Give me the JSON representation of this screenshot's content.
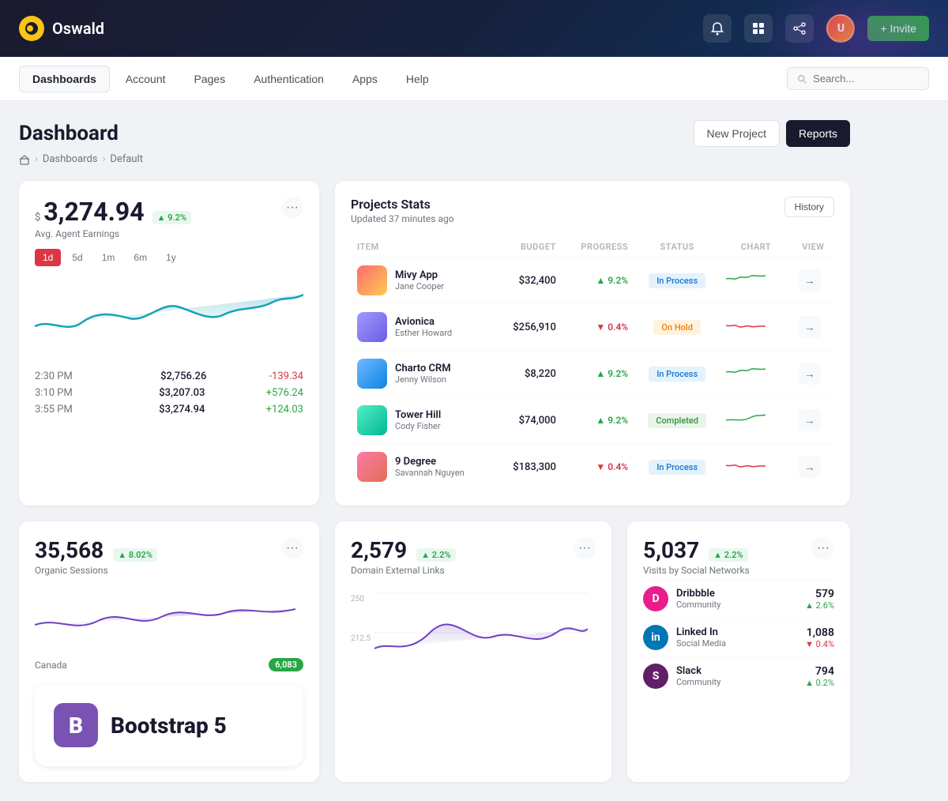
{
  "header": {
    "logo_text": "Oswald",
    "invite_label": "+ Invite"
  },
  "nav": {
    "items": [
      {
        "label": "Dashboards",
        "active": true
      },
      {
        "label": "Account",
        "active": false
      },
      {
        "label": "Pages",
        "active": false
      },
      {
        "label": "Authentication",
        "active": false
      },
      {
        "label": "Apps",
        "active": false
      },
      {
        "label": "Help",
        "active": false
      }
    ],
    "search_placeholder": "Search..."
  },
  "page": {
    "title": "Dashboard",
    "breadcrumb": [
      "Dashboards",
      "Default"
    ],
    "actions": {
      "new_project": "New Project",
      "reports": "Reports"
    }
  },
  "earnings_card": {
    "currency": "$",
    "amount": "3,274.94",
    "badge": "▲ 9.2%",
    "label": "Avg. Agent Earnings",
    "time_filters": [
      "1d",
      "5d",
      "1m",
      "6m",
      "1y"
    ],
    "active_filter": "1d",
    "entries": [
      {
        "time": "2:30 PM",
        "amount": "$2,756.26",
        "change": "-139.34",
        "pos": false
      },
      {
        "time": "3:10 PM",
        "amount": "$3,207.03",
        "change": "+576.24",
        "pos": true
      },
      {
        "time": "3:55 PM",
        "amount": "$3,274.94",
        "change": "+124.03",
        "pos": true
      }
    ]
  },
  "projects_card": {
    "title": "Projects Stats",
    "updated": "Updated 37 minutes ago",
    "history_btn": "History",
    "columns": [
      "ITEM",
      "BUDGET",
      "PROGRESS",
      "STATUS",
      "CHART",
      "VIEW"
    ],
    "rows": [
      {
        "name": "Mivy App",
        "person": "Jane Cooper",
        "budget": "$32,400",
        "progress": "▲ 9.2%",
        "progress_up": true,
        "status": "In Process",
        "thumb_color": "#ff6b6b"
      },
      {
        "name": "Avionica",
        "person": "Esther Howard",
        "budget": "$256,910",
        "progress": "▼ 0.4%",
        "progress_up": false,
        "status": "On Hold",
        "thumb_color": "#a29bfe"
      },
      {
        "name": "Charto CRM",
        "person": "Jenny Wilson",
        "budget": "$8,220",
        "progress": "▲ 9.2%",
        "progress_up": true,
        "status": "In Process",
        "thumb_color": "#74b9ff"
      },
      {
        "name": "Tower Hill",
        "person": "Cody Fisher",
        "budget": "$74,000",
        "progress": "▲ 9.2%",
        "progress_up": true,
        "status": "Completed",
        "thumb_color": "#55efc4"
      },
      {
        "name": "9 Degree",
        "person": "Savannah Nguyen",
        "budget": "$183,300",
        "progress": "▼ 0.4%",
        "progress_up": false,
        "status": "In Process",
        "thumb_color": "#fd79a8"
      }
    ]
  },
  "organic_sessions": {
    "number": "35,568",
    "badge": "▲ 8.02%",
    "label": "Organic Sessions"
  },
  "domain_links": {
    "number": "2,579",
    "badge": "▲ 2.2%",
    "label": "Domain External Links"
  },
  "social_networks": {
    "number": "5,037",
    "badge": "▲ 2.2%",
    "label": "Visits by Social Networks",
    "items": [
      {
        "name": "Dribbble",
        "type": "Community",
        "value": "579",
        "change": "▲ 2.6%",
        "up": true,
        "color": "#e91e8c"
      },
      {
        "name": "Linked In",
        "type": "Social Media",
        "value": "1,088",
        "change": "▼ 0.4%",
        "up": false,
        "color": "#0077b5"
      },
      {
        "name": "Slack",
        "type": "Community",
        "value": "794",
        "change": "▲ 0.2%",
        "up": true,
        "color": "#611f69"
      }
    ]
  },
  "bootstrap": {
    "label": "Bootstrap 5",
    "icon": "B"
  },
  "canada": {
    "label": "Canada",
    "value": "6,083"
  }
}
